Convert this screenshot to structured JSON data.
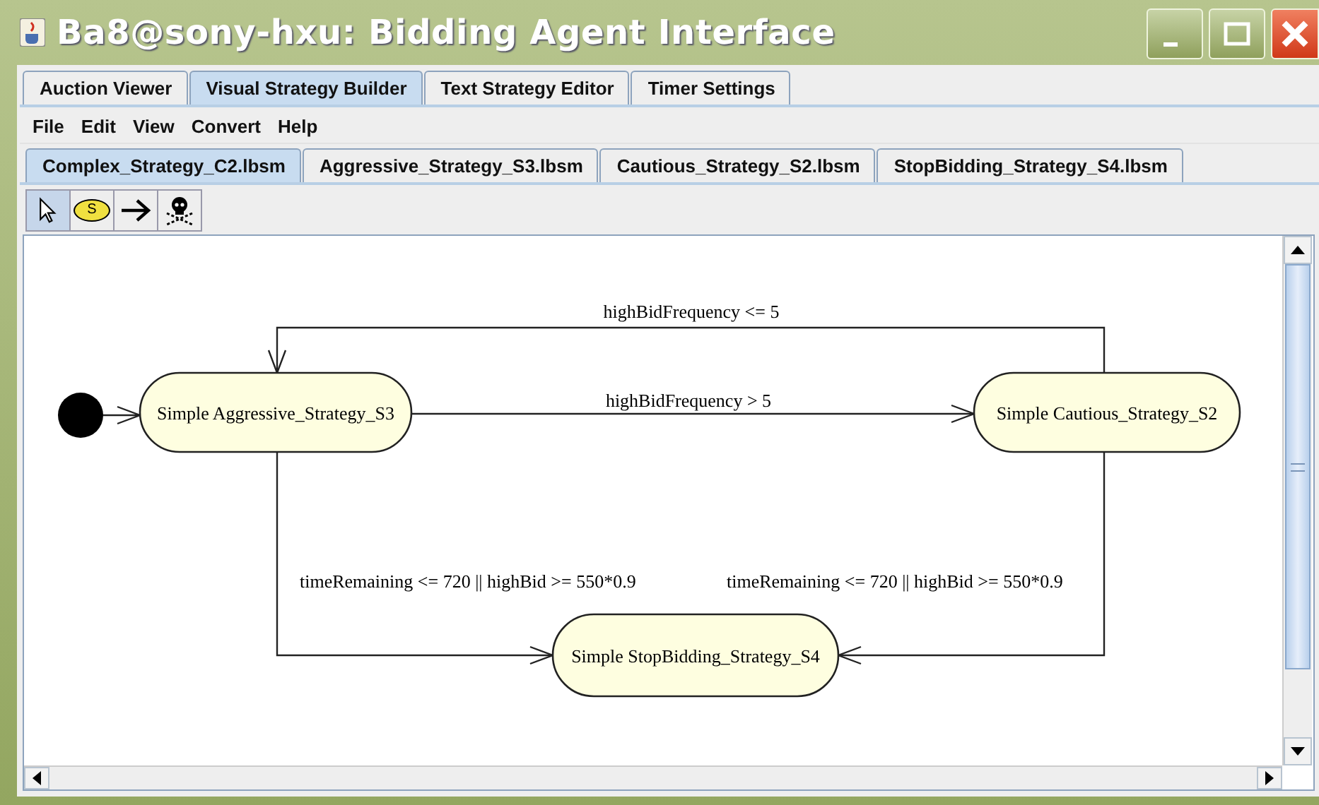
{
  "window": {
    "title": "Ba8@sony-hxu: Bidding Agent Interface"
  },
  "tabs": [
    {
      "label": "Auction Viewer",
      "selected": false
    },
    {
      "label": "Visual Strategy Builder",
      "selected": true
    },
    {
      "label": "Text Strategy Editor",
      "selected": false
    },
    {
      "label": "Timer Settings",
      "selected": false
    }
  ],
  "menu": [
    "File",
    "Edit",
    "View",
    "Convert",
    "Help"
  ],
  "file_tabs": [
    {
      "label": "Complex_Strategy_C2.lbsm",
      "selected": true
    },
    {
      "label": "Aggressive_Strategy_S3.lbsm",
      "selected": false
    },
    {
      "label": "Cautious_Strategy_S2.lbsm",
      "selected": false
    },
    {
      "label": "StopBidding_Strategy_S4.lbsm",
      "selected": false
    }
  ],
  "tools": [
    {
      "kind": "select",
      "selected": true
    },
    {
      "kind": "state",
      "label": "S",
      "selected": false
    },
    {
      "kind": "transition",
      "selected": false
    },
    {
      "kind": "terminal",
      "selected": false
    }
  ],
  "diagram": {
    "states": [
      {
        "label": "Simple Aggressive_Strategy_S3"
      },
      {
        "label": "Simple Cautious_Strategy_S2"
      },
      {
        "label": "Simple StopBidding_Strategy_S4"
      }
    ],
    "transitions": [
      {
        "label": "highBidFrequency <= 5"
      },
      {
        "label": "highBidFrequency > 5"
      },
      {
        "label": "timeRemaining <= 720 || highBid >= 550*0.9"
      },
      {
        "label": "timeRemaining <= 720 || highBid >= 550*0.9"
      }
    ]
  }
}
